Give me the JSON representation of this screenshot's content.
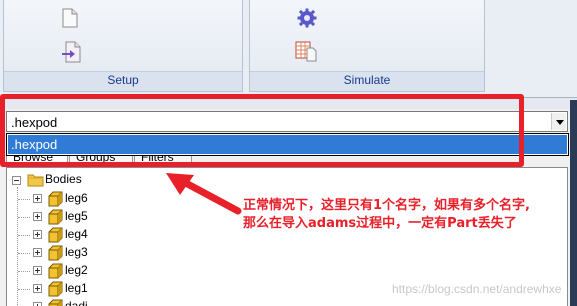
{
  "ribbon": {
    "groups": [
      {
        "label": "Setup",
        "icons": [
          "blank-document-icon",
          "import-document-icon"
        ]
      },
      {
        "label": "Simulate",
        "icons": [
          "gear-icon",
          "table-sheet-icon"
        ]
      }
    ]
  },
  "model_combo": {
    "value": ".hexpod",
    "options": [
      ".hexpod"
    ],
    "selected": ".hexpod"
  },
  "tabs": [
    {
      "label": "Browse",
      "active": true
    },
    {
      "label": "Groups",
      "active": false
    },
    {
      "label": "Filters",
      "active": false
    }
  ],
  "tree": {
    "root": {
      "label": "Bodies",
      "expanded": true,
      "icon": "folder-icon"
    },
    "children": [
      {
        "label": "leg6",
        "icon": "part-cube-icon"
      },
      {
        "label": "leg5",
        "icon": "part-cube-icon"
      },
      {
        "label": "leg4",
        "icon": "part-cube-icon"
      },
      {
        "label": "leg3",
        "icon": "part-cube-icon"
      },
      {
        "label": "leg2",
        "icon": "part-cube-icon"
      },
      {
        "label": "leg1",
        "icon": "part-cube-icon"
      },
      {
        "label": "dadi",
        "icon": "part-cube-icon"
      }
    ]
  },
  "annotation": {
    "line1": "正常情况下，这里只有1个名字，如果有多个名字,",
    "line2": "那么在导入adams过程中，一定有Part丢失了",
    "color": "#e8202a"
  },
  "watermark": "https://blog.csdn.net/andrewhxe"
}
